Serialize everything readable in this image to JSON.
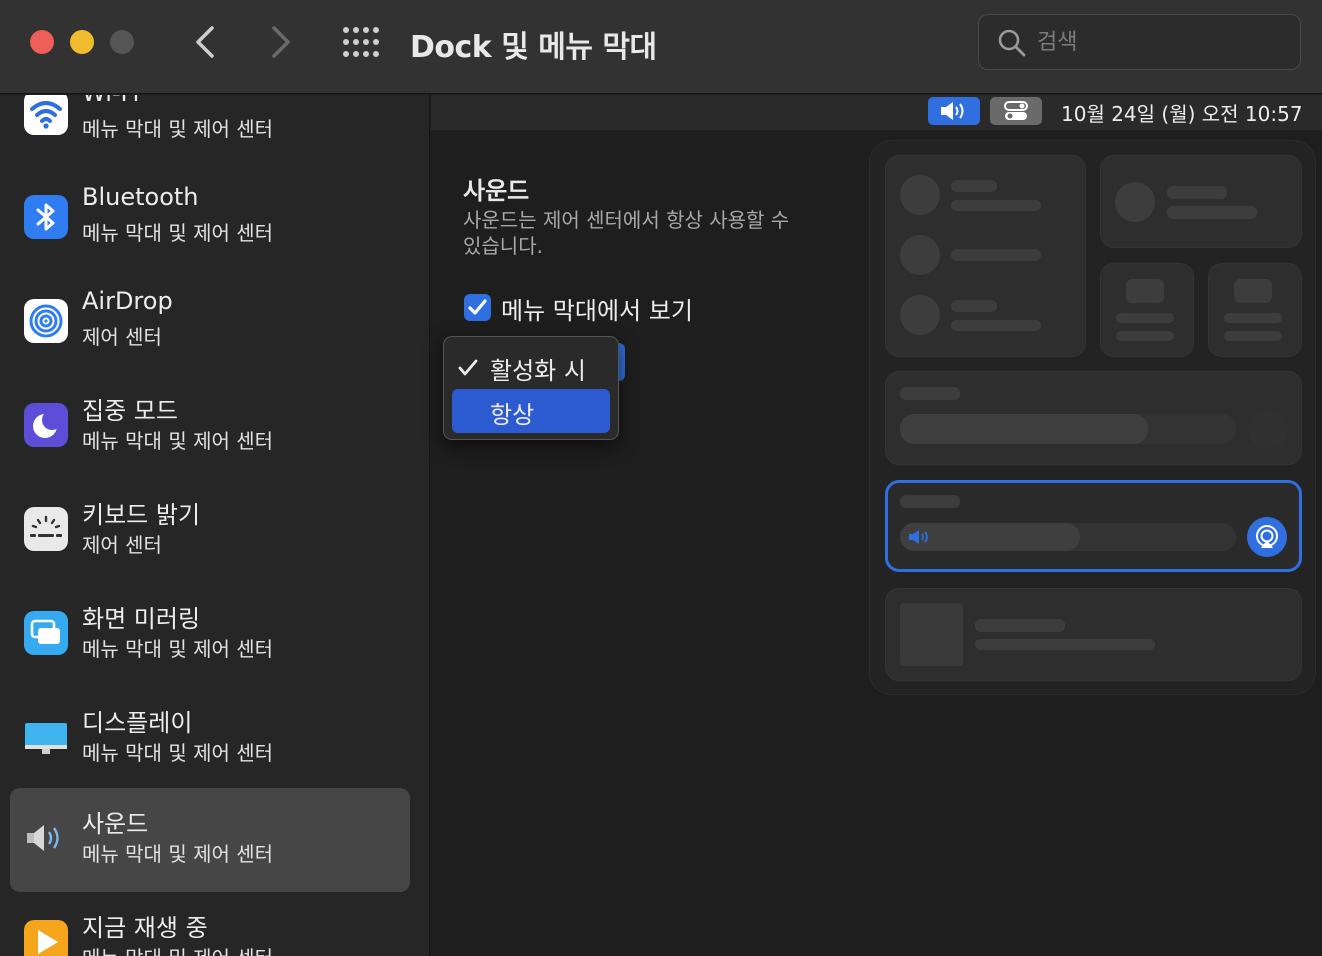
{
  "window": {
    "title": "Dock 및 메뉴 막대"
  },
  "search": {
    "placeholder": "검색",
    "value": ""
  },
  "sidebar": {
    "items": [
      {
        "title": "Wi-Fi",
        "subtitle": "메뉴 막대 및 제어 센터",
        "icon": "wifi-icon"
      },
      {
        "title": "Bluetooth",
        "subtitle": "메뉴 막대 및 제어 센터",
        "icon": "bluetooth-icon"
      },
      {
        "title": "AirDrop",
        "subtitle": "제어 센터",
        "icon": "airdrop-icon"
      },
      {
        "title": "집중 모드",
        "subtitle": "메뉴 막대 및 제어 센터",
        "icon": "moon-icon"
      },
      {
        "title": "키보드 밝기",
        "subtitle": "제어 센터",
        "icon": "keyboard-brightness-icon"
      },
      {
        "title": "화면 미러링",
        "subtitle": "메뉴 막대 및 제어 센터",
        "icon": "screen-mirroring-icon"
      },
      {
        "title": "디스플레이",
        "subtitle": "메뉴 막대 및 제어 센터",
        "icon": "display-icon"
      },
      {
        "title": "사운드",
        "subtitle": "메뉴 막대 및 제어 센터",
        "icon": "speaker-icon",
        "selected": true
      },
      {
        "title": "지금 재생 중",
        "subtitle": "메뉴 막대 및 제어 센터",
        "icon": "now-playing-icon"
      }
    ]
  },
  "menubar": {
    "clock": "10월 24일 (월) 오전  10:57"
  },
  "main": {
    "section_title": "사운드",
    "description": "사운드는 제어 센터에서 항상 사용할 수 있습니다.",
    "show_in_menubar_label": "메뉴 막대에서 보기",
    "show_in_menubar_checked": true
  },
  "popup": {
    "options": [
      {
        "label": "활성화 시",
        "checked": true
      },
      {
        "label": "항상",
        "highlighted": true
      }
    ]
  },
  "colors": {
    "accent": "#2f6fdf",
    "highlight": "#2c5bd1",
    "window_bg": "#1e1e1e",
    "sidebar_bg": "#262626",
    "toolbar_bg": "#323232"
  }
}
